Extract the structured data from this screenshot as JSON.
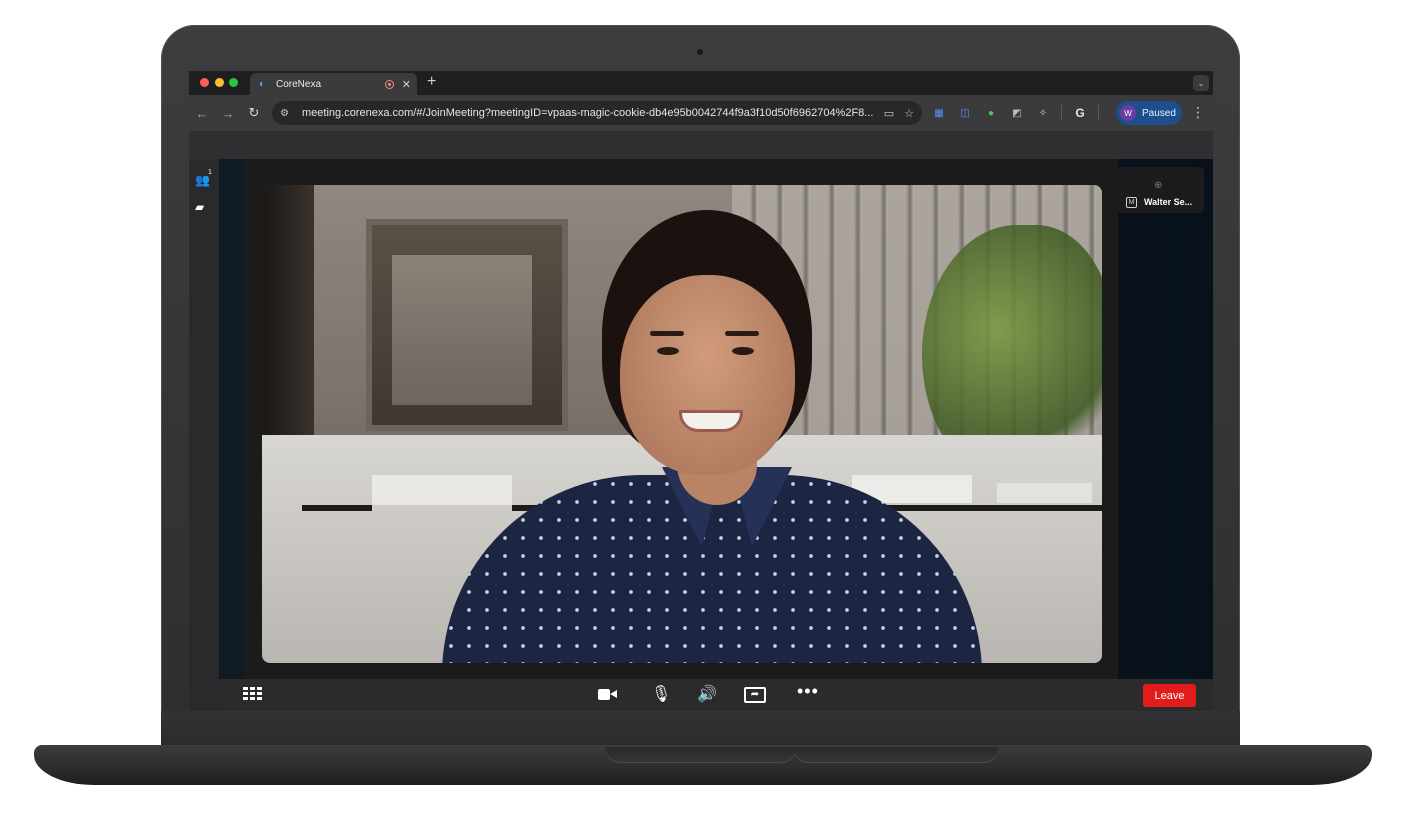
{
  "browser": {
    "tab_title": "CoreNexa",
    "tab_favicon": "corenexa-icon",
    "url": "meeting.corenexa.com/#/JoinMeeting?meetingID=vpaas-magic-cookie-db4e95b0042744f9a3f10d50f6962704%2F8...",
    "profile_initial": "W",
    "profile_status": "Paused",
    "icons": {
      "new_tab": "+",
      "close": "✕",
      "dropdown": "⌄",
      "back": "←",
      "forward": "→",
      "reload": "↻",
      "menu": "⋮",
      "google": "G"
    }
  },
  "meeting": {
    "participants_count": "1",
    "speaker_name": "Walter Se...",
    "speaker_status_glyph": "M",
    "leave_label": "Leave"
  },
  "colors": {
    "leave_red": "#e21b1b",
    "profile_pill": "#1d4f8c",
    "chrome_dark": "#1f1f1f"
  }
}
